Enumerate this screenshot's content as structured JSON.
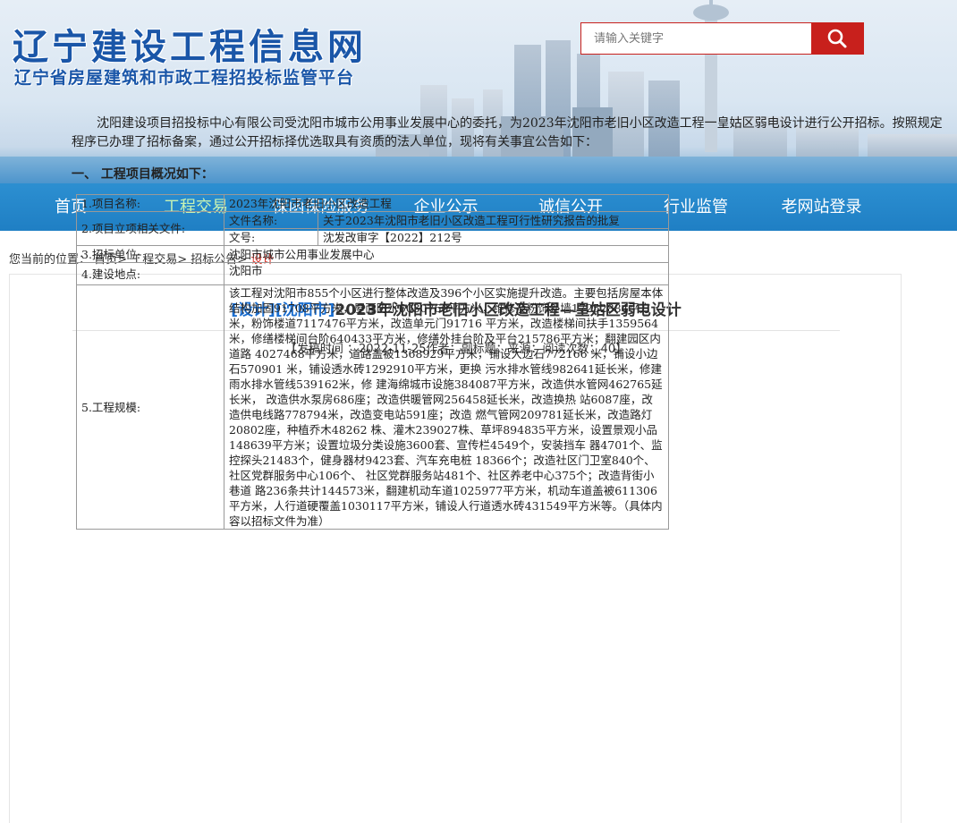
{
  "header": {
    "site_title": "辽宁建设工程信息网",
    "site_subtitle": "辽宁省房屋建筑和市政工程招投标监管平台",
    "search_placeholder": "请输入关键字",
    "search_icon": "search-icon"
  },
  "nav": {
    "items": [
      {
        "label": "首页"
      },
      {
        "label": "工程交易"
      },
      {
        "label": "保函保险服务"
      },
      {
        "label": "企业公示"
      },
      {
        "label": "诚信公开"
      },
      {
        "label": "行业监管"
      },
      {
        "label": "老网站登录"
      }
    ],
    "active_index": 1
  },
  "breadcrumb": {
    "prefix": "您当前的位置：",
    "home": "首页",
    "level1": "工程交易",
    "level2": "招标公告",
    "current": "设计",
    "sep": ">"
  },
  "article": {
    "tag1": "[设计]",
    "tag2": "[沈阳市]",
    "title": "2023年沈阳市老旧小区改造工程—皇姑区弱电设计",
    "meta": "【发稿时间 ：2022-11-25作者：副标题：来源：阅读次数：40】",
    "intro": "沈阳建设项目招投标中心有限公司受沈阳市城市公用事业发展中心的委托，为2023年沈阳市老旧小区改造工程一皇姑区弱电设计进行公开招标。按照规定程序已办理了招标备案，通过公开招标择优选取具有资质的法人单位，现将有关事宜公告如下：",
    "section1": "一、  工程项目概况如下："
  },
  "table": {
    "row1_label": "1.项目名称:",
    "row1_value": "2023年沈阳市老旧小区改造工程",
    "row2_label": "2.项目立项相关文件:",
    "row2_sub1_label": "文件名称:",
    "row2_sub1_value": "关于2023年沈阳市老旧小区改造工程可行性研究报告的批复",
    "row2_sub2_label": "文号:",
    "row2_sub2_value": "沈发改审字【2022】212号",
    "row3_label": "3.招标单位:",
    "row3_value": "沈阳市城市公用事业发展中心",
    "row4_label": "4.建设地点:",
    "row4_value": "沈阳市",
    "row5_label": "5.工程规模:",
    "row5_value": "该工程对沈阳市855个小区进行整体改造及396个小区实施提升改造。主要包括房屋本体结构加固91708平方米，屋面防水6030760平方米，维修及粉饰外墙17252884平方米，粉饰楼道7117476平方米，改造单元门91716 平方米，改造楼梯间扶手1359564米，修缮楼梯间台阶640433平方米，修缮外挂台阶及平台215786平方米；翻建园区内道路    4027468平方米，道路盖被1368929平方米，铺设大边石772166 米，铺设小边石570901 米，铺设透水砖1292910平方米，更换 污水排水管线982641延长米，修建雨水排水管线539162米，修 建海绵城市设施384087平方米，改造供水管网462765延长米，  改造供水泵房686座；改造供暖管网256458延长米，改造换热 站6087座，改造供电线路778794米，改造变电站591座；改造 燃气管网209781延长米，改造路灯20802座，种植乔木48262 株、灌木239027株、草坪894835平方米，设置景观小品148639平方米；设置垃圾分类设施3600套、宣传栏4549个，安装挡车 器4701个、监控探头21483个，健身器材9423套、汽车充电桩 18366个；改造社区门卫室840个、社区党群服务中心106个、 社区党群服务站481个、社区养老中心375个；改造背街小巷道 路236条共计144573米，翻建机动车道1025977平方米，机动车道盖被611306平方米，人行道硬覆盖1030117平方米，铺设人行道透水砖431549平方米等。（具体内容以招标文件为准）"
  },
  "colors": {
    "nav_bg": "#1f7fc4",
    "nav_active": "#c7f2b4",
    "search_btn": "#c8201c",
    "tag_blue": "#1c6fd0",
    "current_red": "#d9261c"
  }
}
